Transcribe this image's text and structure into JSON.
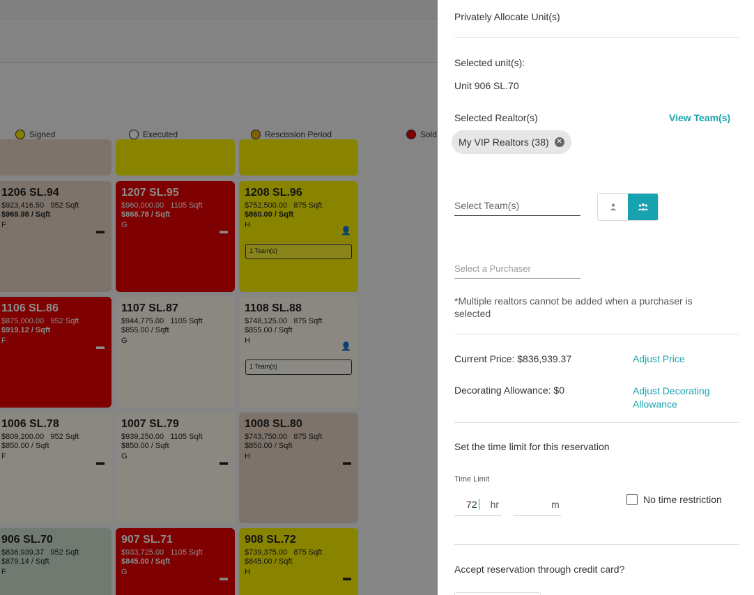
{
  "legend": [
    {
      "label": "Signed",
      "color": "#f2e600"
    },
    {
      "label": "Executed",
      "color": "#ffffff"
    },
    {
      "label": "Rescission Period",
      "color": "#f0b000"
    },
    {
      "label": "Sold",
      "color": "#e60000"
    }
  ],
  "units": {
    "u1206": {
      "title": "1206 SL.94",
      "price": "$923,416.50",
      "sqft": "952 Sqft",
      "per_sqft": "$969.98 / Sqft",
      "letter": "F",
      "icon": "card-icon"
    },
    "u1207": {
      "title": "1207 SL.95",
      "price": "$960,000.00",
      "sqft": "1105 Sqft",
      "per_sqft": "$868.78 / Sqft",
      "letter": "G",
      "icon": "card-icon"
    },
    "u1208": {
      "title": "1208 SL.96",
      "price": "$752,500.00",
      "sqft": "875 Sqft",
      "per_sqft": "$860.00 / Sqft",
      "letter": "H",
      "icon": "person-lock-icon",
      "team": "1 Team(s)"
    },
    "u1106": {
      "title": "1106 SL.86",
      "price": "$875,000.00",
      "sqft": "952 Sqft",
      "per_sqft": "$919.12 / Sqft",
      "letter": "F",
      "icon": "card-icon"
    },
    "u1107": {
      "title": "1107 SL.87",
      "price": "$944,775.00",
      "sqft": "1105 Sqft",
      "per_sqft": "$855.00 / Sqft",
      "letter": "G"
    },
    "u1108": {
      "title": "1108 SL.88",
      "price": "$748,125.00",
      "sqft": "875 Sqft",
      "per_sqft": "$855.00 / Sqft",
      "letter": "H",
      "icon": "person-lock-icon",
      "team": "1 Team(s)"
    },
    "u1006": {
      "title": "1006 SL.78",
      "price": "$809,200.00",
      "sqft": "952 Sqft",
      "per_sqft": "$850.00 / Sqft",
      "letter": "F",
      "icon": "card-icon"
    },
    "u1007": {
      "title": "1007 SL.79",
      "price": "$939,250.00",
      "sqft": "1105 Sqft",
      "per_sqft": "$850.00 / Sqft",
      "letter": "G",
      "icon": "card-icon"
    },
    "u1008": {
      "title": "1008 SL.80",
      "price": "$743,750.00",
      "sqft": "875 Sqft",
      "per_sqft": "$850.00 / Sqft",
      "letter": "H",
      "icon": "card-icon"
    },
    "u906": {
      "title": "906 SL.70",
      "price": "$836,939.37",
      "sqft": "952 Sqft",
      "per_sqft": "$879.14 / Sqft",
      "letter": "F"
    },
    "u907": {
      "title": "907 SL.71",
      "price": "$933,725.00",
      "sqft": "1105 Sqft",
      "per_sqft": "$845.00 / Sqft",
      "letter": "G",
      "icon": "card-icon"
    },
    "u908": {
      "title": "908 SL.72",
      "price": "$739,375.00",
      "sqft": "875 Sqft",
      "per_sqft": "$845.00 / Sqft",
      "letter": "H",
      "icon": "card-icon"
    }
  },
  "panel": {
    "title": "Privately Allocate Unit(s)",
    "selected_units_label": "Selected unit(s):",
    "selected_units_value": "Unit 906 SL.70",
    "selected_realtors_label": "Selected Realtor(s)",
    "view_teams_link": "View Team(s)",
    "realtor_chip": "My VIP Realtors (38)",
    "select_team_placeholder": "Select Team(s)",
    "select_purchaser_placeholder": "Select a Purchaser",
    "note": "*Multiple realtors cannot be added when a purchaser is selected",
    "current_price": "Current Price: $836,939.37",
    "adjust_price_link": "Adjust Price",
    "decorating_allowance": "Decorating Allowance: $0",
    "adjust_decorating_link": "Adjust Decorating Allowance",
    "time_limit_heading": "Set the time limit for this reservation",
    "time_limit_label": "Time Limit",
    "hours_value": "72",
    "hours_unit": "hr",
    "minutes_unit": "m",
    "no_time_restriction": "No time restriction",
    "credit_card_question": "Accept reservation through credit card?"
  }
}
